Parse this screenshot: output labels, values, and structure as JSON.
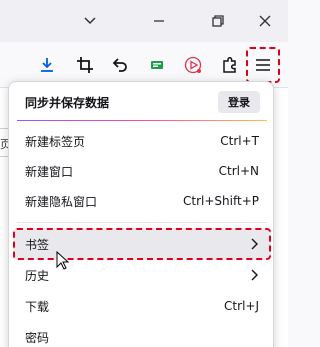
{
  "window": {
    "controls": {
      "chevron_icon": "chevron-down-icon",
      "minimize_icon": "minimize-icon",
      "restore_icon": "restore-icon",
      "close_icon": "close-icon"
    }
  },
  "toolbar": {
    "icons": [
      "download-icon",
      "crop-screenshot-icon",
      "undo-icon",
      "extension-green-icon",
      "play-recorder-icon",
      "extensions-puzzle-icon",
      "hamburger-menu-icon"
    ],
    "accent": "#0060df"
  },
  "page": {
    "partial_text": "页"
  },
  "menu": {
    "sync_title": "同步并保存数据",
    "login_label": "登录",
    "items": [
      {
        "label": "新建标签页",
        "shortcut": "Ctrl+T"
      },
      {
        "label": "新建窗口",
        "shortcut": "Ctrl+N"
      },
      {
        "label": "新建隐私窗口",
        "shortcut": "Ctrl+Shift+P"
      },
      {
        "label": "书签",
        "shortcut": ""
      },
      {
        "label": "历史",
        "shortcut": ""
      },
      {
        "label": "下载",
        "shortcut": "Ctrl+J"
      },
      {
        "label": "密码",
        "shortcut": ""
      }
    ]
  },
  "annotation": {
    "color": "#e0001b"
  }
}
